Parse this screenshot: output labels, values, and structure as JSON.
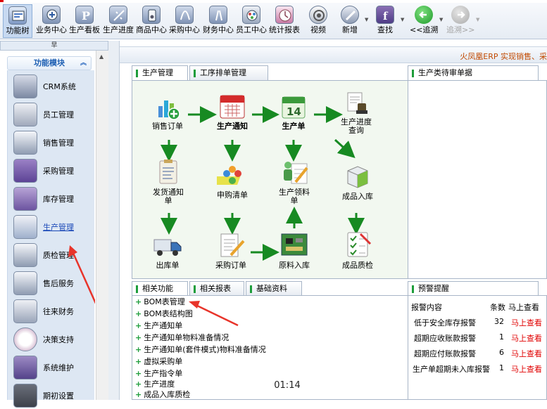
{
  "toolbar": {
    "items": [
      {
        "label": "功能树",
        "icon": "function-tree-icon"
      },
      {
        "label": "业务中心",
        "icon": "business-center-icon"
      },
      {
        "label": "生产看板",
        "icon": "production-board-icon"
      },
      {
        "label": "生产进度",
        "icon": "production-progress-icon"
      },
      {
        "label": "商品中心",
        "icon": "goods-center-icon"
      },
      {
        "label": "采购中心",
        "icon": "purchase-center-icon"
      },
      {
        "label": "财务中心",
        "icon": "finance-center-icon"
      },
      {
        "label": "员工中心",
        "icon": "staff-center-icon"
      },
      {
        "label": "统计报表",
        "icon": "statistics-report-icon"
      },
      {
        "label": "视频",
        "icon": "video-icon"
      },
      {
        "label": "新增",
        "icon": "add-new-icon"
      },
      {
        "label": "查找",
        "icon": "search-icon"
      },
      {
        "label": "<<追溯",
        "icon": "trace-back-icon"
      },
      {
        "label": "追溯>>",
        "icon": "trace-forward-icon"
      }
    ]
  },
  "sidebar": {
    "handle": "早",
    "title": "功能模块",
    "items": [
      {
        "label": "CRM系统"
      },
      {
        "label": "员工管理"
      },
      {
        "label": "销售管理"
      },
      {
        "label": "采购管理"
      },
      {
        "label": "库存管理"
      },
      {
        "label": "生产管理"
      },
      {
        "label": "质检管理"
      },
      {
        "label": "售后服务"
      },
      {
        "label": "往来财务"
      },
      {
        "label": "决策支持"
      },
      {
        "label": "系统维护"
      },
      {
        "label": "期初设置"
      }
    ]
  },
  "banner": {
    "text": "火凤凰ERP 实现销售、采"
  },
  "flow_tabs": [
    "生产管理",
    "工序排单管理"
  ],
  "flow_nodes": [
    {
      "label": "销售订单"
    },
    {
      "label": "生产通知"
    },
    {
      "label": "生产单"
    },
    {
      "label": "生产进度查询"
    },
    {
      "label": "发货通知单"
    },
    {
      "label": "申购清单"
    },
    {
      "label": "生产领料单"
    },
    {
      "label": "成品入库"
    },
    {
      "label": "出库单"
    },
    {
      "label": "采购订单"
    },
    {
      "label": "原料入库"
    },
    {
      "label": "成品质检"
    }
  ],
  "pending": {
    "tab": "生产类待审单据"
  },
  "bottom_tabs": [
    "相关功能",
    "相关报表",
    "基础资料"
  ],
  "links": [
    "BOM表管理",
    "BOM表结构图",
    "生产通知单",
    "生产通知单物料准备情况",
    "生产通知单(套件模式)物料准备情况",
    "虚拟采购单",
    "生产指令单",
    "生产进度",
    "成品入库质检"
  ],
  "alert": {
    "tab": "预警提醒",
    "headers": {
      "content": "报警内容",
      "count": "条数",
      "view": "马上查看"
    },
    "rows": [
      {
        "name": "低于安全库存报警",
        "count": "32",
        "view": "马上查看"
      },
      {
        "name": "超期应收账款报警",
        "count": "1",
        "view": "马上查看"
      },
      {
        "name": "超期应付账款报警",
        "count": "6",
        "view": "马上查看"
      },
      {
        "name": "生产单超期未入库报警",
        "count": "1",
        "view": "马上查看"
      }
    ]
  },
  "clock": "01:14"
}
